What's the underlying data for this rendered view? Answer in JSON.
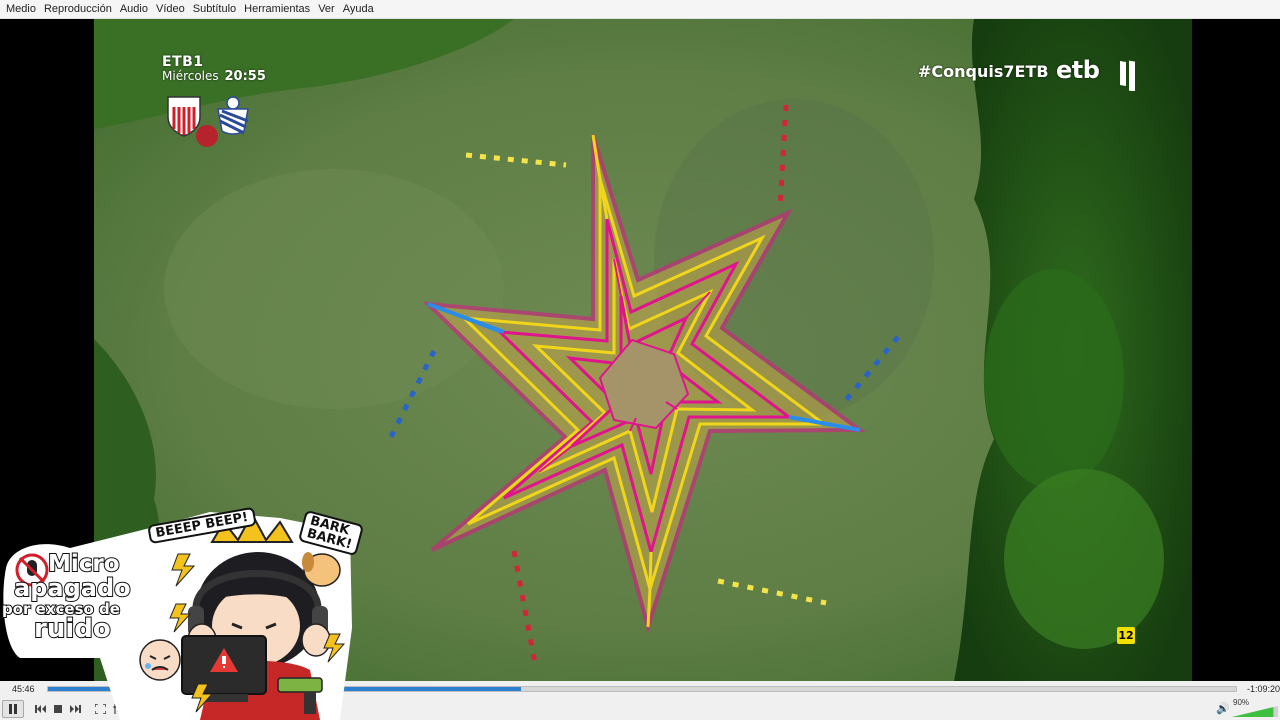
{
  "menu": [
    "Medio",
    "Reproducción",
    "Audio",
    "Vídeo",
    "Subtítulo",
    "Herramientas",
    "Ver",
    "Ayuda"
  ],
  "broadcast": {
    "channel": "ETB1",
    "day": "Miércoles",
    "time": "20:55",
    "hashtag": "#Conquis7ETB",
    "logo": "etb",
    "age_rating": "12"
  },
  "sticker": {
    "line1": "Micro",
    "line2": "apagado",
    "line3": "por exceso de",
    "line4": "ruido",
    "bubble_left": "BEEEP BEEP!",
    "bubble_right": "BARK BARK!"
  },
  "player": {
    "elapsed": "45:46",
    "remaining": "-1:09:20",
    "progress": 0.398,
    "volume_label": "90%",
    "volume": 0.9
  },
  "colors": {
    "accent": "#2f7fd1",
    "menubar_bg": "#f5f5f5",
    "star_magenta": "#e0148c",
    "star_yellow": "#f1d51a",
    "star_blue": "#2a8ee8",
    "age_badge": "#f3e000"
  },
  "icons": [
    "pause-icon",
    "prev-icon",
    "stop-icon",
    "next-icon",
    "fullscreen-icon",
    "extended-settings-icon",
    "playlist-icon",
    "loop-icon",
    "shuffle-icon",
    "volume-icon"
  ]
}
